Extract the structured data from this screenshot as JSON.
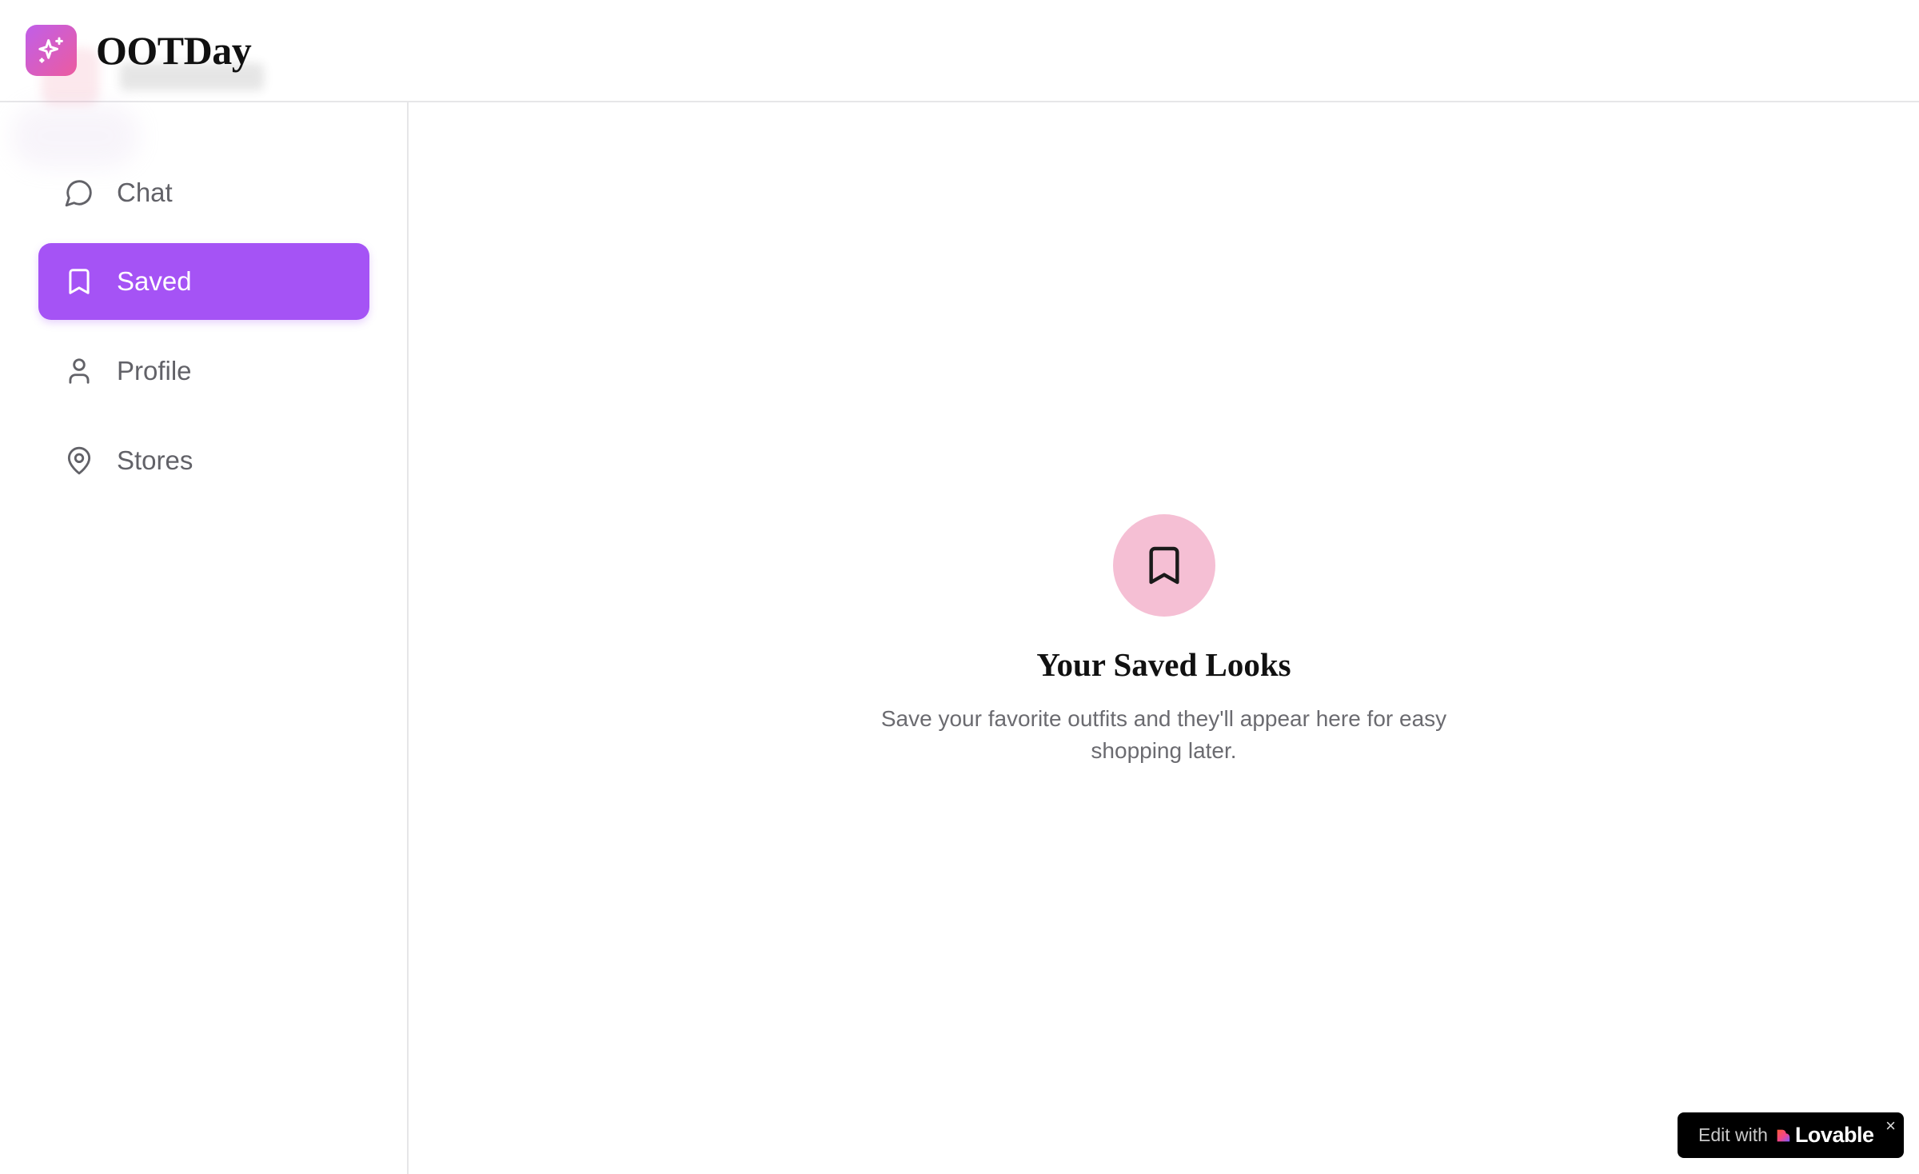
{
  "app": {
    "name": "OOTDay",
    "logo_icon": "sparkles-icon",
    "brand_gradient": [
      "#c05ee9",
      "#ec5c9f"
    ]
  },
  "sidebar": {
    "items": [
      {
        "id": "chat",
        "label": "Chat",
        "icon": "message-circle-icon",
        "active": false
      },
      {
        "id": "saved",
        "label": "Saved",
        "icon": "bookmark-icon",
        "active": true
      },
      {
        "id": "profile",
        "label": "Profile",
        "icon": "user-icon",
        "active": false
      },
      {
        "id": "stores",
        "label": "Stores",
        "icon": "map-pin-icon",
        "active": false
      }
    ],
    "active_color": "#a553f5"
  },
  "main": {
    "empty_state": {
      "icon": "bookmark-icon",
      "icon_bg": "#f5bfd4",
      "title": "Your Saved Looks",
      "description": "Save your favorite outfits and they'll appear here for easy shopping later."
    }
  },
  "badge": {
    "prefix": "Edit with",
    "brand": "Lovable",
    "close": "×"
  }
}
